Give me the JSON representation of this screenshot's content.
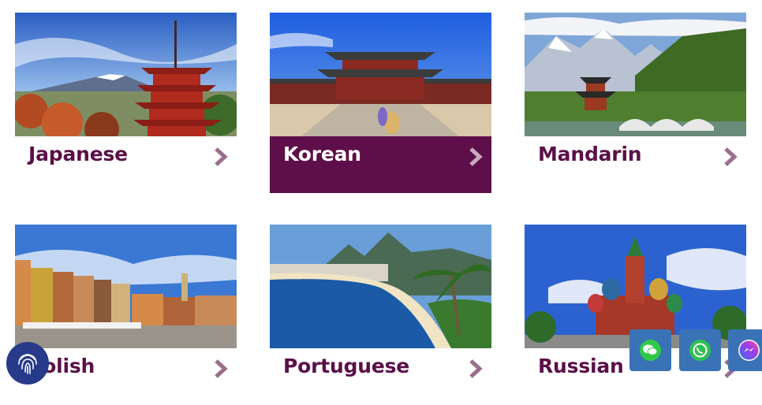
{
  "cards": [
    {
      "label": "Japanese",
      "active": false
    },
    {
      "label": "Korean",
      "active": true
    },
    {
      "label": "Mandarin",
      "active": false
    },
    {
      "label": "Polish",
      "active": false
    },
    {
      "label": "Portuguese",
      "active": false
    },
    {
      "label": "Russian",
      "active": false
    }
  ],
  "icons": {
    "chevron": "chevron-right-icon",
    "fingerprint": "fingerprint-icon",
    "wechat": "wechat-icon",
    "whatsapp": "whatsapp-icon",
    "messenger": "messenger-icon"
  },
  "colors": {
    "label": "#5a1048",
    "active_bar": "#5e0e49",
    "chevron": "#9a6e8c",
    "fab": "#3a73b5",
    "fingerprint_bg": "#283a8a",
    "wechat": "#2fc94a",
    "whatsapp": "#2fbf52"
  }
}
